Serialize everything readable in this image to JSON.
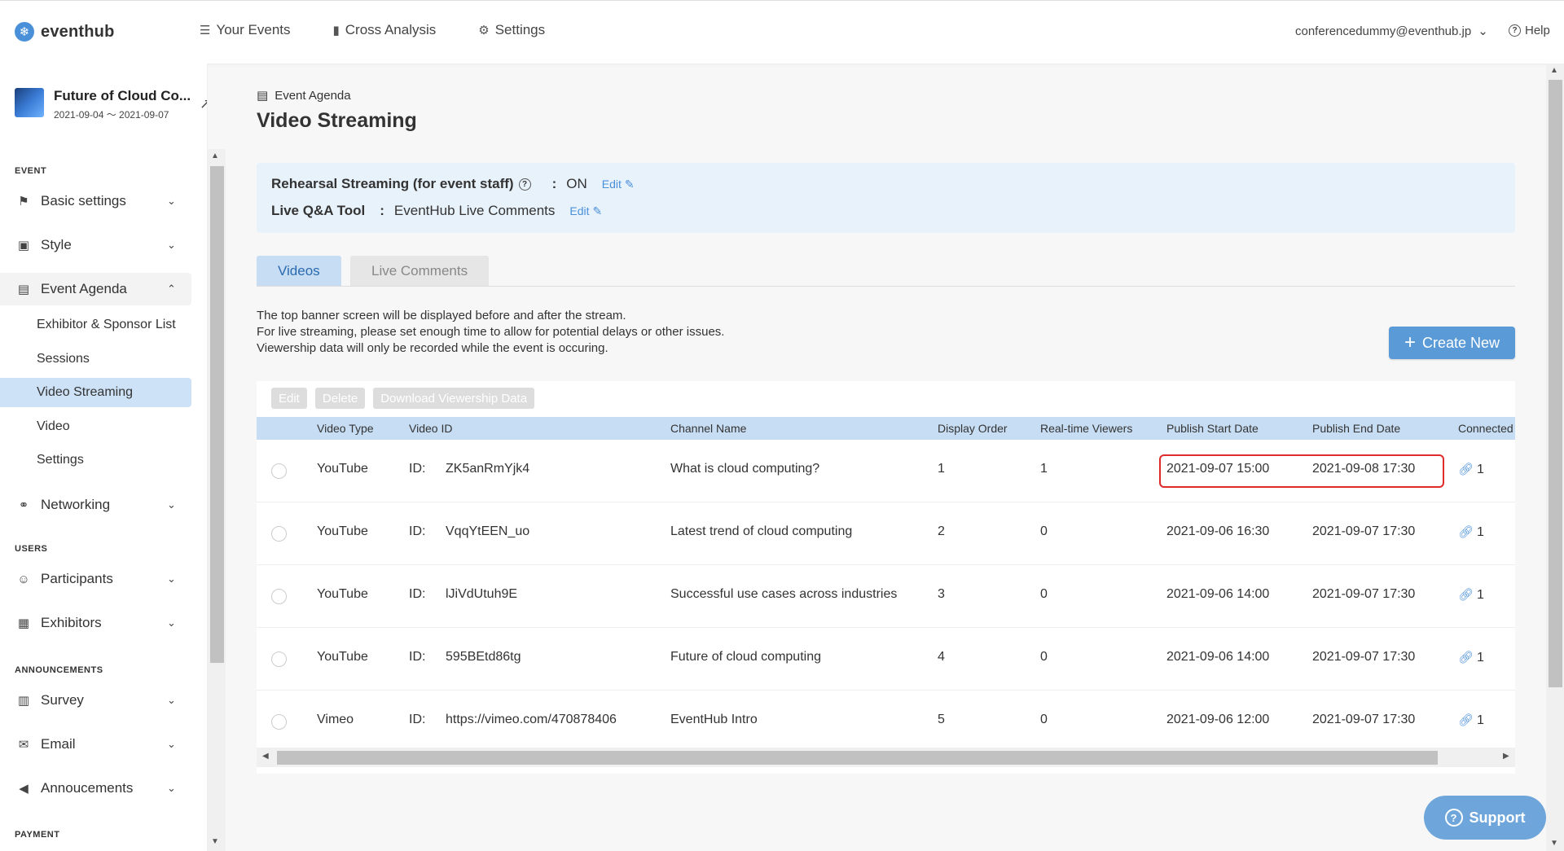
{
  "app": {
    "logo_text": "eventhub",
    "brand_color": "#4a90d9"
  },
  "topnav": [
    {
      "label": "Your Events",
      "icon": "list-icon"
    },
    {
      "label": "Cross Analysis",
      "icon": "bar-chart-icon"
    },
    {
      "label": "Settings",
      "icon": "gear-icon"
    }
  ],
  "user": {
    "email": "conferencedummy@eventhub.jp"
  },
  "help": {
    "label": "Help"
  },
  "event": {
    "name": "Future of Cloud Co...",
    "dates": "2021-09-04 ～ 2021-09-07"
  },
  "sidebar": {
    "section_event": "EVENT",
    "section_users": "USERS",
    "section_announcements": "ANNOUNCEMENTS",
    "section_payment": "PAYMENT",
    "basic_settings": "Basic settings",
    "style": "Style",
    "event_agenda": "Event Agenda",
    "sub": {
      "exhibitor": "Exhibitor & Sponsor List",
      "sessions": "Sessions",
      "video_streaming": "Video Streaming",
      "video": "Video",
      "settings": "Settings"
    },
    "networking": "Networking",
    "participants": "Participants",
    "exhibitors": "Exhibitors",
    "survey": "Survey",
    "email": "Email",
    "announcements": "Annoucements"
  },
  "page": {
    "breadcrumb": "Event Agenda",
    "title": "Video Streaming"
  },
  "info": {
    "rehearsal_label": "Rehearsal Streaming (for event staff)",
    "rehearsal_value": "ON",
    "qa_label": "Live Q&A Tool",
    "qa_value": "EventHub Live Comments",
    "sep": ":",
    "edit": "Edit"
  },
  "tabs": {
    "videos": "Videos",
    "live_comments": "Live Comments"
  },
  "notes": {
    "line1": "The top banner screen will be displayed before and after the stream.",
    "line2": "For live streaming, please set enough time to allow for potential delays or other issues.",
    "line3": "Viewership data will only be recorded while the event is occuring."
  },
  "create_new": "Create New",
  "toolbar": {
    "edit": "Edit",
    "delete": "Delete",
    "download": "Download Viewership Data"
  },
  "table": {
    "headers": {
      "video_type": "Video Type",
      "video_id": "Video ID",
      "channel_name": "Channel Name",
      "display_order": "Display Order",
      "viewers": "Real-time Viewers",
      "start": "Publish Start Date",
      "end": "Publish End Date",
      "connected": "Connected"
    },
    "id_prefix": "ID:",
    "rows": [
      {
        "type": "YouTube",
        "id": "ZK5anRmYjk4",
        "channel": "What is cloud computing?",
        "order": "1",
        "viewers": "1",
        "start": "2021-09-07 15:00",
        "end": "2021-09-08 17:30",
        "connected": "1"
      },
      {
        "type": "YouTube",
        "id": "VqqYtEEN_uo",
        "channel": "Latest trend of cloud computing",
        "order": "2",
        "viewers": "0",
        "start": "2021-09-06 16:30",
        "end": "2021-09-07 17:30",
        "connected": "1"
      },
      {
        "type": "YouTube",
        "id": "lJiVdUtuh9E",
        "channel": "Successful use cases across industries",
        "order": "3",
        "viewers": "0",
        "start": "2021-09-06 14:00",
        "end": "2021-09-07 17:30",
        "connected": "1"
      },
      {
        "type": "YouTube",
        "id": "595BEtd86tg",
        "channel": "Future of cloud computing",
        "order": "4",
        "viewers": "0",
        "start": "2021-09-06 14:00",
        "end": "2021-09-07 17:30",
        "connected": "1"
      },
      {
        "type": "Vimeo",
        "id": "https://vimeo.com/470878406",
        "channel": "EventHub Intro",
        "order": "5",
        "viewers": "0",
        "start": "2021-09-06 12:00",
        "end": "2021-09-07 17:30",
        "connected": "1"
      }
    ]
  },
  "support": "Support"
}
